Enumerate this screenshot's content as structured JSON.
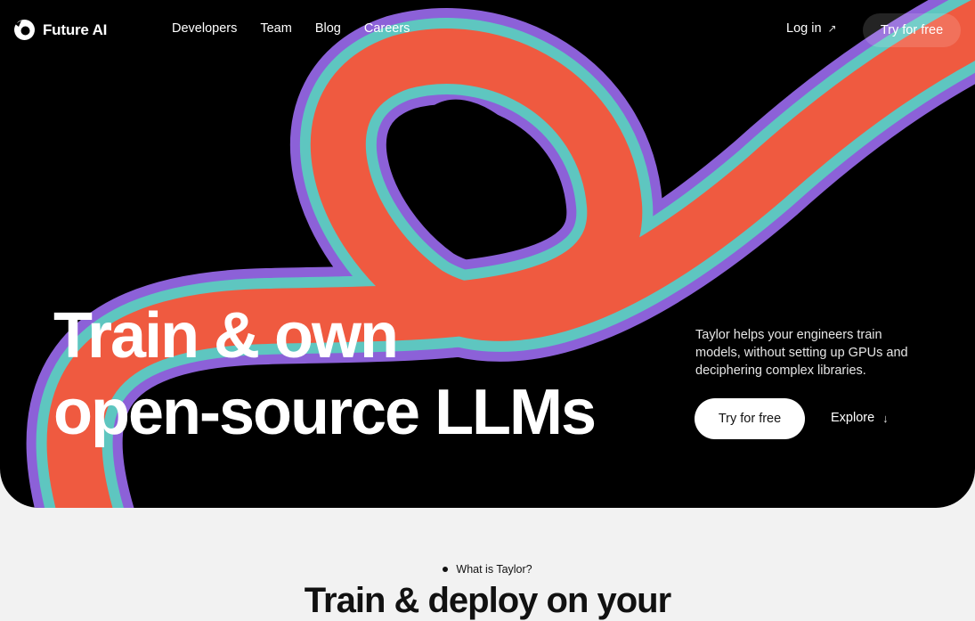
{
  "brand": {
    "name": "Future AI"
  },
  "nav": {
    "links": [
      "Developers",
      "Team",
      "Blog",
      "Careers"
    ],
    "login_label": "Log in",
    "login_icon": "arrow-up-right-icon",
    "try_label": "Try for free"
  },
  "hero": {
    "headline_line1": "Train & own",
    "headline_line2": "open-source LLMs",
    "description": "Taylor helps your engineers train models, without setting up GPUs and deciphering complex libraries.",
    "primary_cta": "Try for free",
    "secondary_cta": "Explore",
    "secondary_icon": "arrow-down-icon",
    "colors": {
      "background": "#000000",
      "ribbon_orange": "#ef5a40",
      "ribbon_purple": "#9b6cf0",
      "ribbon_teal": "#5ec6c0"
    }
  },
  "section": {
    "eyebrow": "What is Taylor?",
    "title": "Train & deploy on your"
  }
}
